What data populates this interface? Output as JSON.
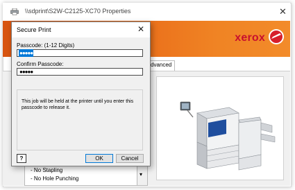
{
  "properties_window": {
    "title": "\\\\sdprint\\S2W-C2125-XC70 Properties",
    "close_glyph": "✕",
    "brand": {
      "logo_text": "xerox",
      "badge_icon": "xerox-sphere-icon",
      "color": "#c8102e"
    },
    "banner_color": "#ea6d1a",
    "visible_tab_label": "dvanced",
    "list_items": [
      "- No Stapling",
      "- No Hole Punching"
    ],
    "scroll_arrow": "▾"
  },
  "secure_print_dialog": {
    "title": "Secure Print",
    "close_glyph": "✕",
    "passcode_label": "Passcode: (1-12 Digits)",
    "passcode_value": "●●●●●",
    "confirm_label": "Confirm Passcode:",
    "confirm_value": "●●●●●",
    "info_text": "This job will be held at the printer until you enter this passcode to release it.",
    "help_label": "?",
    "ok_label": "OK",
    "cancel_label": "Cancel"
  }
}
